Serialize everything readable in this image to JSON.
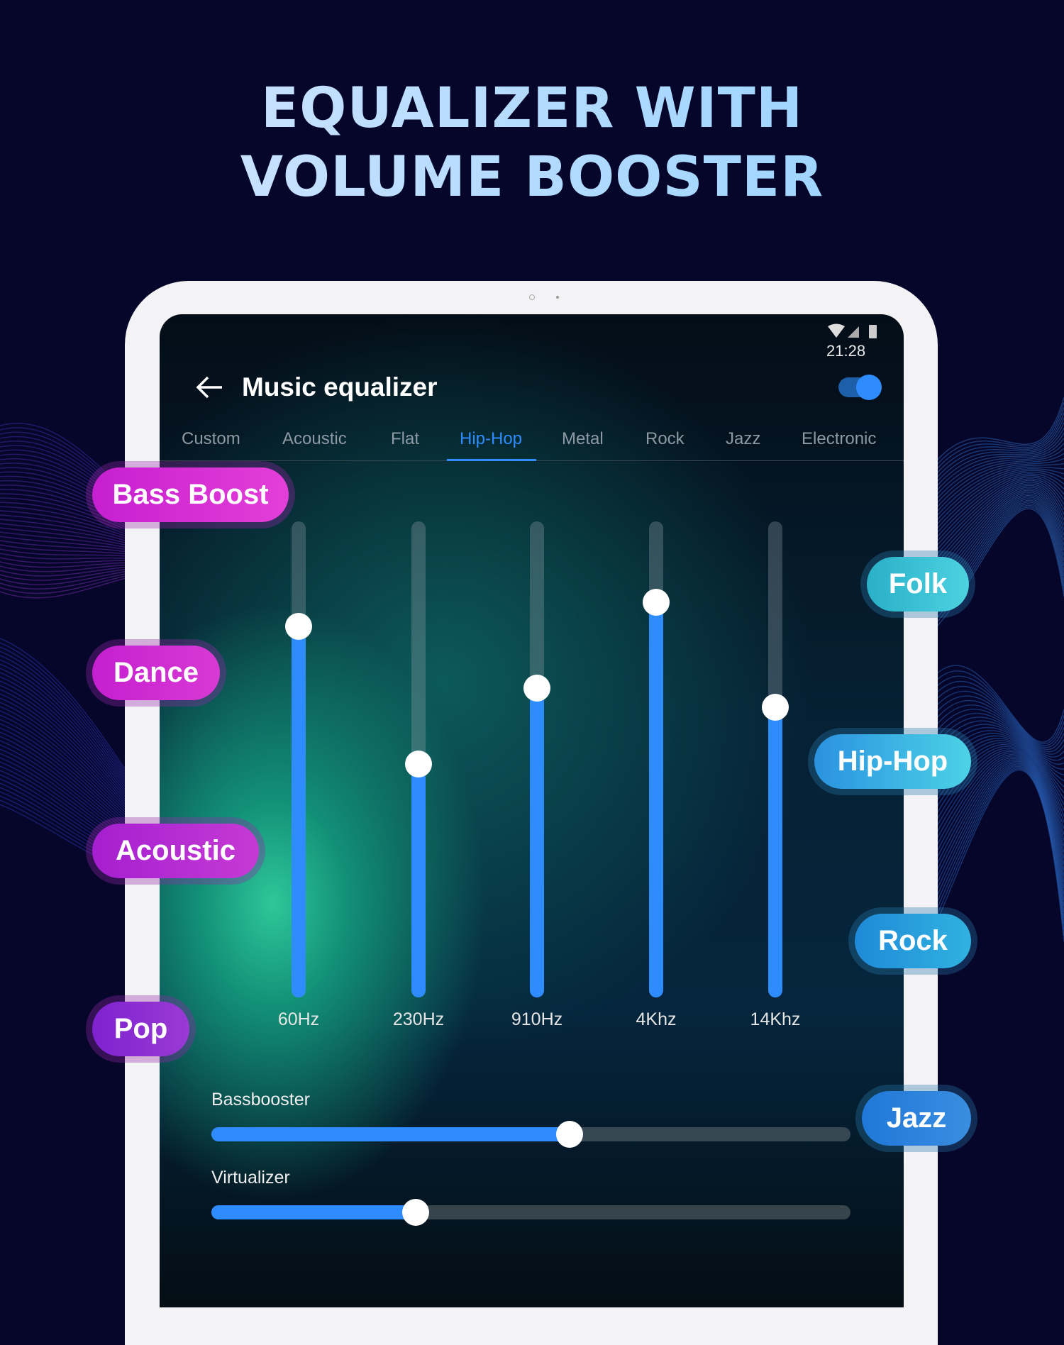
{
  "headline": [
    "EQUALIZER WITH",
    "VOLUME BOOSTER"
  ],
  "status": {
    "time": "21:28",
    "icons": [
      "wifi-icon",
      "signal-icon",
      "battery-charging-icon"
    ]
  },
  "header": {
    "title": "Music equalizer",
    "back_icon": "arrow-left-icon",
    "enabled": true
  },
  "tabs": [
    {
      "label": "Custom"
    },
    {
      "label": "Acoustic"
    },
    {
      "label": "Flat"
    },
    {
      "label": "Hip-Hop",
      "active": true
    },
    {
      "label": "Metal"
    },
    {
      "label": "Rock"
    },
    {
      "label": "Jazz"
    },
    {
      "label": "Electronic"
    }
  ],
  "bands": [
    {
      "label": "60Hz",
      "level": 0.78
    },
    {
      "label": "230Hz",
      "level": 0.49
    },
    {
      "label": "910Hz",
      "level": 0.65
    },
    {
      "label": "4Khz",
      "level": 0.83
    },
    {
      "label": "14Khz",
      "level": 0.61
    }
  ],
  "bassbooster": {
    "label": "Bassbooster",
    "value": 0.56
  },
  "virtualizer": {
    "label": "Virtualizer",
    "value": 0.32
  },
  "presets_left": [
    "Bass Boost",
    "Dance",
    "Acoustic",
    "Pop"
  ],
  "presets_right": [
    "Folk",
    "Hip-Hop",
    "Rock",
    "Jazz"
  ],
  "colors": {
    "accent": "#2f8cff",
    "background": "#05062a"
  }
}
